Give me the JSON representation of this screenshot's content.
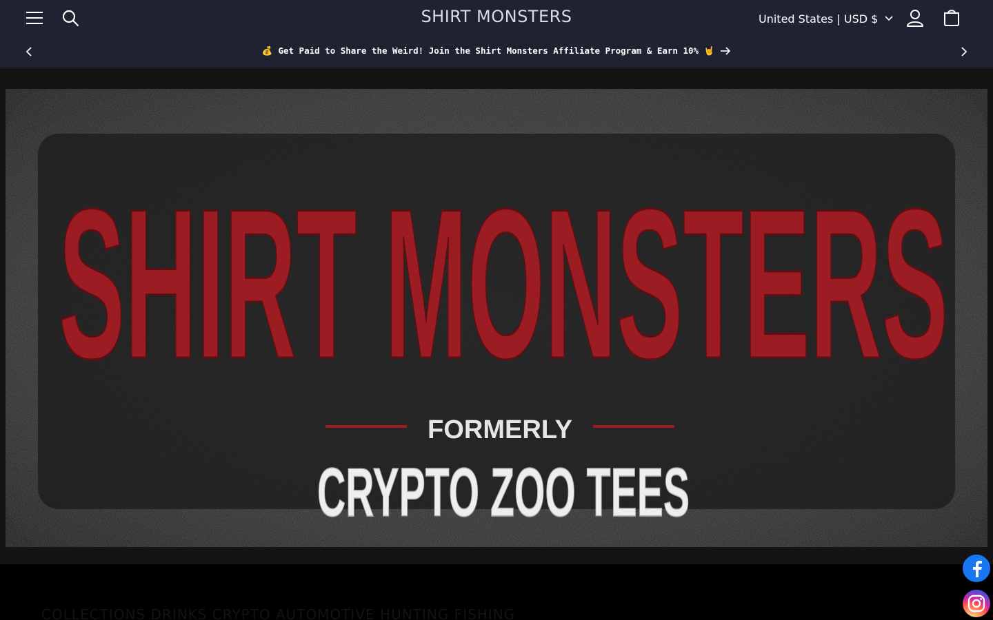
{
  "header": {
    "brand": "SHIRT MONSTERS",
    "locale_label": "United States | USD $",
    "icons": {
      "menu": "hamburger-menu-icon",
      "search": "search-icon",
      "account": "account-icon",
      "cart": "cart-icon",
      "locale_caret": "chevron-down-icon"
    }
  },
  "announcement": {
    "emoji": "💰",
    "text": "Get Paid to Share the Weird! Join the Shirt Monsters Affiliate Program & Earn 10% 🤘"
  },
  "hero": {
    "logo_title": "SHIRT MONSTERS",
    "logo_formerly": "FORMERLY",
    "logo_subtitle": "CRYPTO ZOO TEES"
  },
  "below_fold": {
    "text": "COLLECTIONS   DRINKS   CRYPTO   AUTOMOTIVE   HUNTING   FISHING"
  },
  "social": {
    "facebook": "facebook-icon",
    "instagram": "instagram-icon"
  },
  "colors": {
    "header_bg": "#1f2230",
    "hero_red": "#9b1c22",
    "hero_white": "#eeeeee",
    "page_bg": "#000000"
  }
}
